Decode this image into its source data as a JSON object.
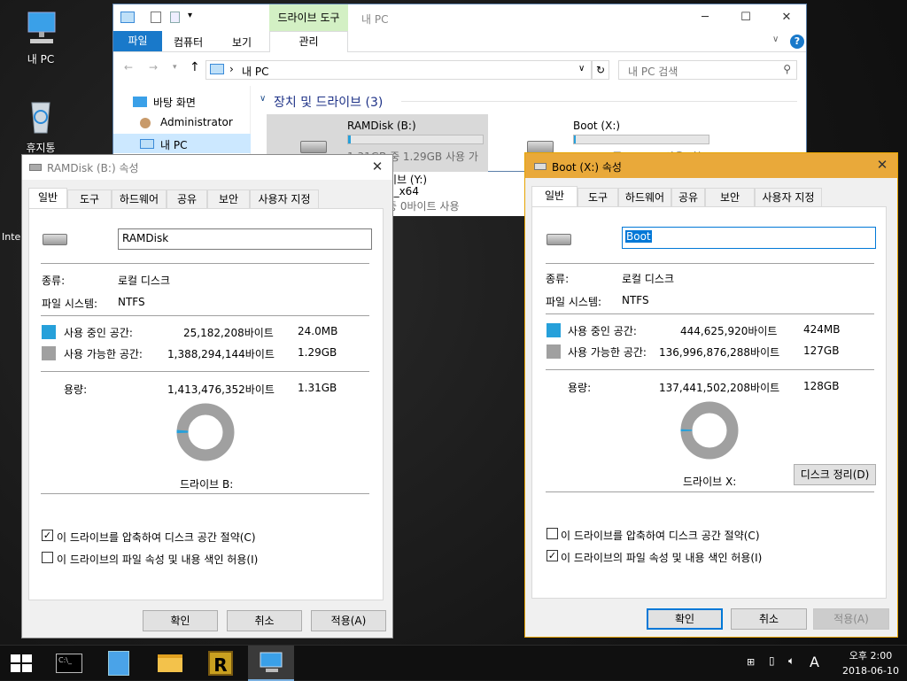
{
  "desktop": {
    "icons": [
      {
        "label": "내 PC",
        "icon": "computer-icon"
      },
      {
        "label": "휴지통",
        "icon": "recycle-bin-icon"
      }
    ],
    "partial_label": "Inte"
  },
  "explorer": {
    "drive_tools_tab": "드라이브 도구",
    "title": "내 PC",
    "ribbon_tabs": [
      "파일",
      "컴퓨터",
      "보기"
    ],
    "manage_tab": "관리",
    "address": "내 PC",
    "search_placeholder": "내 PC 검색",
    "nav": [
      "바탕 화면",
      "Administrator",
      "내 PC"
    ],
    "section": "장치 및 드라이브 (3)",
    "drives": [
      {
        "name": "RAMDisk (B:)",
        "free": "1.31GB 중 1.29GB 사용 가",
        "fill": 0.02
      },
      {
        "name": "Boot (X:)",
        "free": "128GB 중 127GB 사용 가능",
        "fill": 0.01
      }
    ],
    "partial": {
      "line1": "이브 (Y:)",
      "line2": "E_x64",
      "line3": "중 0바이트 사용"
    }
  },
  "dialog_b": {
    "title": "RAMDisk (B:) 속성",
    "tabs": [
      "일반",
      "도구",
      "하드웨어",
      "공유",
      "보안",
      "사용자 지정"
    ],
    "name_value": "RAMDisk",
    "type_label": "종류:",
    "type_value": "로컬 디스크",
    "fs_label": "파일 시스템:",
    "fs_value": "NTFS",
    "used_label": "사용 중인 공간:",
    "used_bytes": "25,182,208바이트",
    "used_short": "24.0MB",
    "free_label": "사용 가능한 공간:",
    "free_bytes": "1,388,294,144바이트",
    "free_short": "1.29GB",
    "cap_label": "용량:",
    "cap_bytes": "1,413,476,352바이트",
    "cap_short": "1.31GB",
    "used_fraction": 0.018,
    "drive_label": "드라이브 B:",
    "compress": "이 드라이브를 압축하여 디스크 공간 절약(C)",
    "compress_checked": true,
    "index": "이 드라이브의 파일 속성 및 내용 색인 허용(I)",
    "index_checked": false,
    "ok": "확인",
    "cancel": "취소",
    "apply": "적용(A)"
  },
  "dialog_x": {
    "title": "Boot (X:) 속성",
    "tabs": [
      "일반",
      "도구",
      "하드웨어",
      "공유",
      "보안",
      "사용자 지정"
    ],
    "name_value": "Boot",
    "type_label": "종류:",
    "type_value": "로컬 디스크",
    "fs_label": "파일 시스템:",
    "fs_value": "NTFS",
    "used_label": "사용 중인 공간:",
    "used_bytes": "444,625,920바이트",
    "used_short": "424MB",
    "free_label": "사용 가능한 공간:",
    "free_bytes": "136,996,876,288바이트",
    "free_short": "127GB",
    "cap_label": "용량:",
    "cap_bytes": "137,441,502,208바이트",
    "cap_short": "128GB",
    "used_fraction": 0.003,
    "drive_label": "드라이브 X:",
    "cleanup": "디스크 정리(D)",
    "compress": "이 드라이브를 압축하여 디스크 공간 절약(C)",
    "compress_checked": false,
    "index": "이 드라이브의 파일 속성 및 내용 색인 허용(I)",
    "index_checked": true,
    "ok": "확인",
    "cancel": "취소",
    "apply": "적용(A)"
  },
  "taskbar": {
    "ime": "A",
    "time": "오후 2:00",
    "date": "2018-06-10"
  },
  "colors": {
    "used": "#26a0da",
    "free": "#a0a0a0",
    "accent": "#0078d7",
    "active_title": "#e9a93a"
  }
}
